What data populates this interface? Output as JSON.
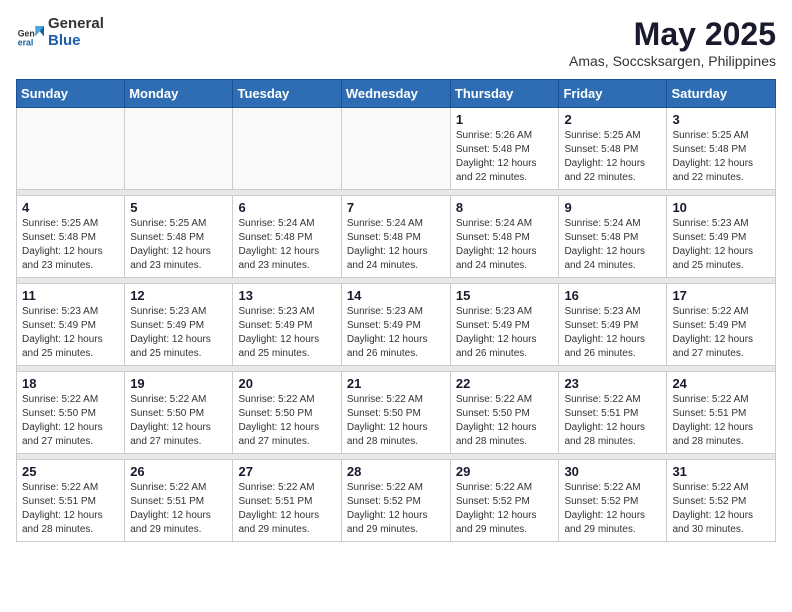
{
  "logo": {
    "general": "General",
    "blue": "Blue"
  },
  "title": "May 2025",
  "location": "Amas, Soccsksargen, Philippines",
  "days_of_week": [
    "Sunday",
    "Monday",
    "Tuesday",
    "Wednesday",
    "Thursday",
    "Friday",
    "Saturday"
  ],
  "weeks": [
    [
      {
        "day": "",
        "info": ""
      },
      {
        "day": "",
        "info": ""
      },
      {
        "day": "",
        "info": ""
      },
      {
        "day": "",
        "info": ""
      },
      {
        "day": "1",
        "info": "Sunrise: 5:26 AM\nSunset: 5:48 PM\nDaylight: 12 hours\nand 22 minutes."
      },
      {
        "day": "2",
        "info": "Sunrise: 5:25 AM\nSunset: 5:48 PM\nDaylight: 12 hours\nand 22 minutes."
      },
      {
        "day": "3",
        "info": "Sunrise: 5:25 AM\nSunset: 5:48 PM\nDaylight: 12 hours\nand 22 minutes."
      }
    ],
    [
      {
        "day": "4",
        "info": "Sunrise: 5:25 AM\nSunset: 5:48 PM\nDaylight: 12 hours\nand 23 minutes."
      },
      {
        "day": "5",
        "info": "Sunrise: 5:25 AM\nSunset: 5:48 PM\nDaylight: 12 hours\nand 23 minutes."
      },
      {
        "day": "6",
        "info": "Sunrise: 5:24 AM\nSunset: 5:48 PM\nDaylight: 12 hours\nand 23 minutes."
      },
      {
        "day": "7",
        "info": "Sunrise: 5:24 AM\nSunset: 5:48 PM\nDaylight: 12 hours\nand 24 minutes."
      },
      {
        "day": "8",
        "info": "Sunrise: 5:24 AM\nSunset: 5:48 PM\nDaylight: 12 hours\nand 24 minutes."
      },
      {
        "day": "9",
        "info": "Sunrise: 5:24 AM\nSunset: 5:48 PM\nDaylight: 12 hours\nand 24 minutes."
      },
      {
        "day": "10",
        "info": "Sunrise: 5:23 AM\nSunset: 5:49 PM\nDaylight: 12 hours\nand 25 minutes."
      }
    ],
    [
      {
        "day": "11",
        "info": "Sunrise: 5:23 AM\nSunset: 5:49 PM\nDaylight: 12 hours\nand 25 minutes."
      },
      {
        "day": "12",
        "info": "Sunrise: 5:23 AM\nSunset: 5:49 PM\nDaylight: 12 hours\nand 25 minutes."
      },
      {
        "day": "13",
        "info": "Sunrise: 5:23 AM\nSunset: 5:49 PM\nDaylight: 12 hours\nand 25 minutes."
      },
      {
        "day": "14",
        "info": "Sunrise: 5:23 AM\nSunset: 5:49 PM\nDaylight: 12 hours\nand 26 minutes."
      },
      {
        "day": "15",
        "info": "Sunrise: 5:23 AM\nSunset: 5:49 PM\nDaylight: 12 hours\nand 26 minutes."
      },
      {
        "day": "16",
        "info": "Sunrise: 5:23 AM\nSunset: 5:49 PM\nDaylight: 12 hours\nand 26 minutes."
      },
      {
        "day": "17",
        "info": "Sunrise: 5:22 AM\nSunset: 5:49 PM\nDaylight: 12 hours\nand 27 minutes."
      }
    ],
    [
      {
        "day": "18",
        "info": "Sunrise: 5:22 AM\nSunset: 5:50 PM\nDaylight: 12 hours\nand 27 minutes."
      },
      {
        "day": "19",
        "info": "Sunrise: 5:22 AM\nSunset: 5:50 PM\nDaylight: 12 hours\nand 27 minutes."
      },
      {
        "day": "20",
        "info": "Sunrise: 5:22 AM\nSunset: 5:50 PM\nDaylight: 12 hours\nand 27 minutes."
      },
      {
        "day": "21",
        "info": "Sunrise: 5:22 AM\nSunset: 5:50 PM\nDaylight: 12 hours\nand 28 minutes."
      },
      {
        "day": "22",
        "info": "Sunrise: 5:22 AM\nSunset: 5:50 PM\nDaylight: 12 hours\nand 28 minutes."
      },
      {
        "day": "23",
        "info": "Sunrise: 5:22 AM\nSunset: 5:51 PM\nDaylight: 12 hours\nand 28 minutes."
      },
      {
        "day": "24",
        "info": "Sunrise: 5:22 AM\nSunset: 5:51 PM\nDaylight: 12 hours\nand 28 minutes."
      }
    ],
    [
      {
        "day": "25",
        "info": "Sunrise: 5:22 AM\nSunset: 5:51 PM\nDaylight: 12 hours\nand 28 minutes."
      },
      {
        "day": "26",
        "info": "Sunrise: 5:22 AM\nSunset: 5:51 PM\nDaylight: 12 hours\nand 29 minutes."
      },
      {
        "day": "27",
        "info": "Sunrise: 5:22 AM\nSunset: 5:51 PM\nDaylight: 12 hours\nand 29 minutes."
      },
      {
        "day": "28",
        "info": "Sunrise: 5:22 AM\nSunset: 5:52 PM\nDaylight: 12 hours\nand 29 minutes."
      },
      {
        "day": "29",
        "info": "Sunrise: 5:22 AM\nSunset: 5:52 PM\nDaylight: 12 hours\nand 29 minutes."
      },
      {
        "day": "30",
        "info": "Sunrise: 5:22 AM\nSunset: 5:52 PM\nDaylight: 12 hours\nand 29 minutes."
      },
      {
        "day": "31",
        "info": "Sunrise: 5:22 AM\nSunset: 5:52 PM\nDaylight: 12 hours\nand 30 minutes."
      }
    ]
  ]
}
